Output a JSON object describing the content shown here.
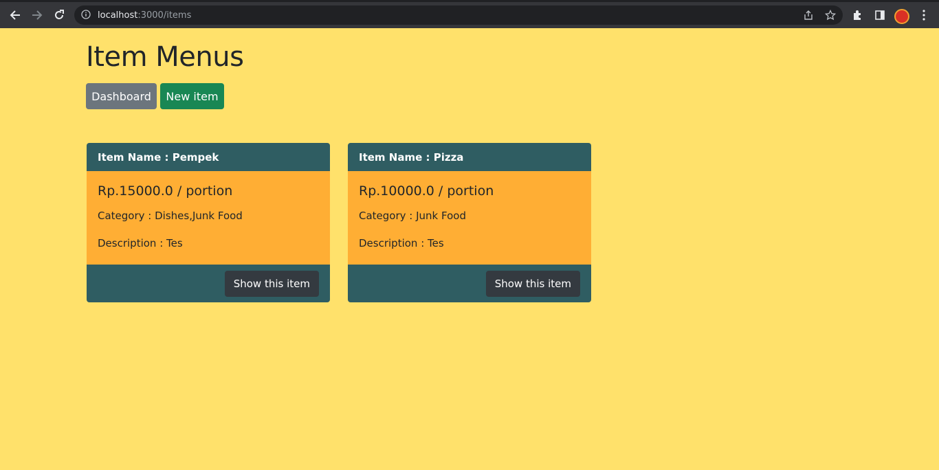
{
  "browser": {
    "url_host": "localhost",
    "url_path": ":3000/items"
  },
  "page": {
    "title": "Item Menus",
    "dashboard_label": "Dashboard",
    "new_item_label": "New item"
  },
  "items": [
    {
      "header": "Item Name : Pempek",
      "price": "Rp.15000.0 / portion",
      "category": "Category : Dishes,Junk Food",
      "description": "Description : Tes",
      "show_label": "Show this item"
    },
    {
      "header": "Item Name : Pizza",
      "price": "Rp.10000.0 / portion",
      "category": "Category : Junk Food",
      "description": "Description : Tes",
      "show_label": "Show this item"
    }
  ]
}
